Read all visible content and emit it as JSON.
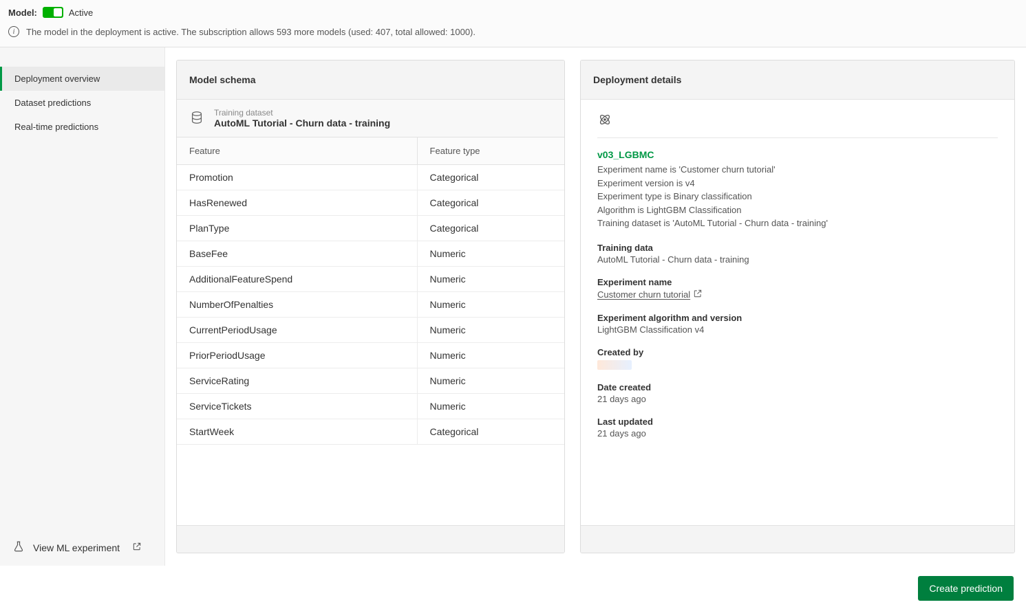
{
  "topbar": {
    "model_label": "Model:",
    "status_text": "Active",
    "info_text": "The model in the deployment is active. The subscription allows 593 more models (used: 407, total allowed: 1000)."
  },
  "sidebar": {
    "items": [
      {
        "label": "Deployment overview",
        "active": true
      },
      {
        "label": "Dataset predictions",
        "active": false
      },
      {
        "label": "Real-time predictions",
        "active": false
      }
    ],
    "bottom_link": "View ML experiment"
  },
  "schema_panel": {
    "header": "Model schema",
    "banner_tiny": "Training dataset",
    "banner_main": "AutoML Tutorial - Churn data - training",
    "col_feature": "Feature",
    "col_type": "Feature type",
    "rows": [
      {
        "feature": "Promotion",
        "type": "Categorical"
      },
      {
        "feature": "HasRenewed",
        "type": "Categorical"
      },
      {
        "feature": "PlanType",
        "type": "Categorical"
      },
      {
        "feature": "BaseFee",
        "type": "Numeric"
      },
      {
        "feature": "AdditionalFeatureSpend",
        "type": "Numeric"
      },
      {
        "feature": "NumberOfPenalties",
        "type": "Numeric"
      },
      {
        "feature": "CurrentPeriodUsage",
        "type": "Numeric"
      },
      {
        "feature": "PriorPeriodUsage",
        "type": "Numeric"
      },
      {
        "feature": "ServiceRating",
        "type": "Numeric"
      },
      {
        "feature": "ServiceTickets",
        "type": "Numeric"
      },
      {
        "feature": "StartWeek",
        "type": "Categorical"
      }
    ]
  },
  "details_panel": {
    "header": "Deployment details",
    "model_name": "v03_LGBMC",
    "lines": [
      "Experiment name is 'Customer churn tutorial'",
      "Experiment version is v4",
      "Experiment type is Binary classification",
      "Algorithm is LightGBM Classification",
      "Training dataset is 'AutoML Tutorial - Churn data - training'"
    ],
    "sections": {
      "training_data": {
        "label": "Training data",
        "value": "AutoML Tutorial - Churn data - training"
      },
      "experiment_name": {
        "label": "Experiment name",
        "value": "Customer churn tutorial"
      },
      "algo_version": {
        "label": "Experiment algorithm and version",
        "value": "LightGBM Classification v4"
      },
      "created_by": {
        "label": "Created by"
      },
      "date_created": {
        "label": "Date created",
        "value": "21 days ago"
      },
      "last_updated": {
        "label": "Last updated",
        "value": "21 days ago"
      }
    }
  },
  "bottom": {
    "create_label": "Create prediction"
  }
}
